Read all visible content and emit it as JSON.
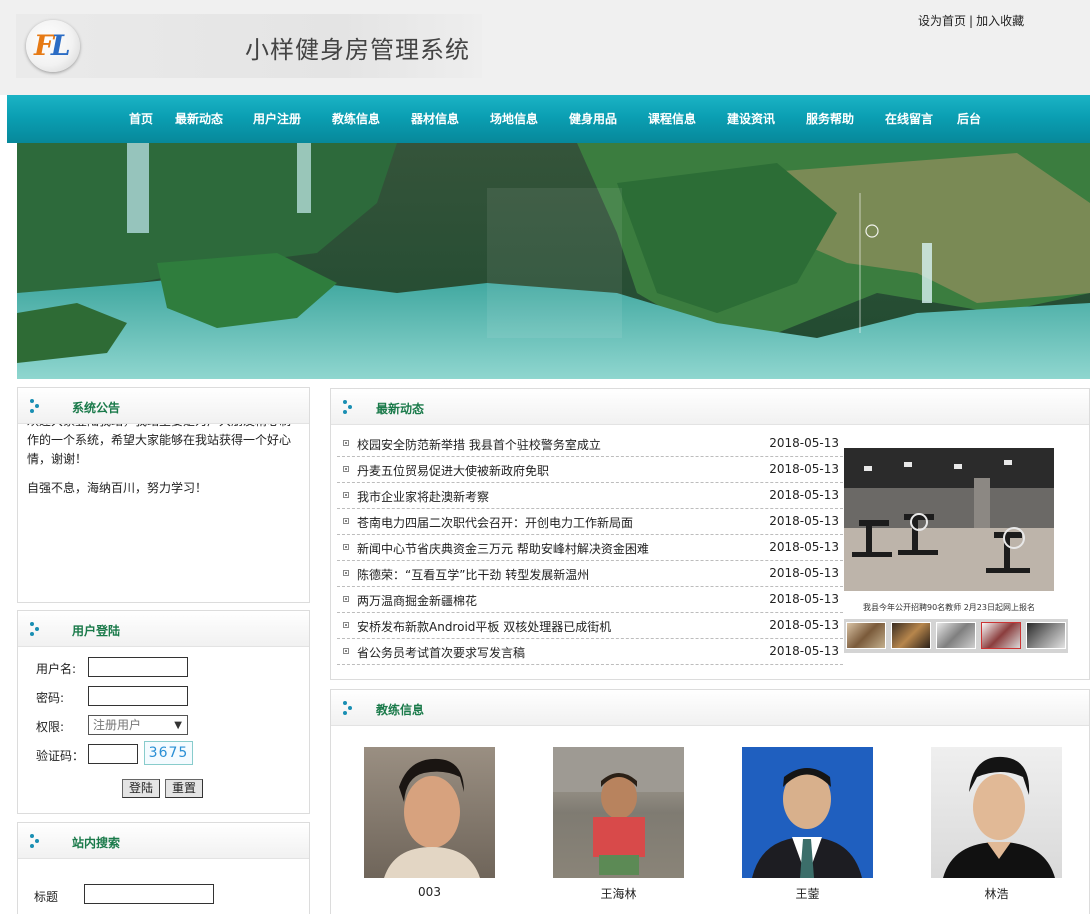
{
  "header": {
    "site_title": "小样健身房管理系统",
    "top_links": [
      "设为首页",
      "加入收藏"
    ],
    "top_links_separator": "|"
  },
  "nav": {
    "items": [
      "首页",
      "最新动态",
      "用户注册",
      "教练信息",
      "器材信息",
      "场地信息",
      "健身用品",
      "课程信息",
      "建设资讯",
      "服务帮助",
      "在线留言",
      "后台"
    ]
  },
  "notice": {
    "title": "系统公告",
    "paragraphs": [
      "欢迎大家登陆我站，我站主要是为广大朋友精心制作的一个系统，希望大家能够在我站获得一个好心情，谢谢！",
      "自强不息，海纳百川，努力学习！"
    ]
  },
  "login": {
    "title": "用户登陆",
    "username_label": "用户名:",
    "username_value": "",
    "password_label": "密码:",
    "password_value": "",
    "role_label": "权限:",
    "role_selected": "注册用户",
    "captcha_label": "验证码：",
    "captcha_value": "",
    "captcha_code": "3675",
    "login_button": "登陆",
    "reset_button": "重置"
  },
  "search": {
    "title": "站内搜索",
    "field_label": "标题",
    "field_value": ""
  },
  "news": {
    "title": "最新动态",
    "items": [
      {
        "title": "校园安全防范新举措 我县首个驻校警务室成立",
        "date": "2018-05-13"
      },
      {
        "title": "丹麦五位贸易促进大使被新政府免职",
        "date": "2018-05-13"
      },
      {
        "title": "我市企业家将赴澳新考察",
        "date": "2018-05-13"
      },
      {
        "title": "苍南电力四届二次职代会召开：开创电力工作新局面",
        "date": "2018-05-13"
      },
      {
        "title": "新闻中心节省庆典资金三万元 帮助安峰村解决资金困难",
        "date": "2018-05-13"
      },
      {
        "title": "陈德荣：“互看互学”比干劲 转型发展新温州",
        "date": "2018-05-13"
      },
      {
        "title": "两万温商掘金新疆棉花",
        "date": "2018-05-13"
      },
      {
        "title": "安桥发布新款Android平板 双核处理器已成街机",
        "date": "2018-05-13"
      },
      {
        "title": "省公务员考试首次要求写发言稿",
        "date": "2018-05-13"
      }
    ],
    "photo_caption": "我县今年公开招聘90名教师 2月23日起网上报名"
  },
  "coaches": {
    "title": "教练信息",
    "items": [
      {
        "name": "003"
      },
      {
        "name": "王海林"
      },
      {
        "name": "王蓥"
      },
      {
        "name": "林浩"
      }
    ]
  }
}
